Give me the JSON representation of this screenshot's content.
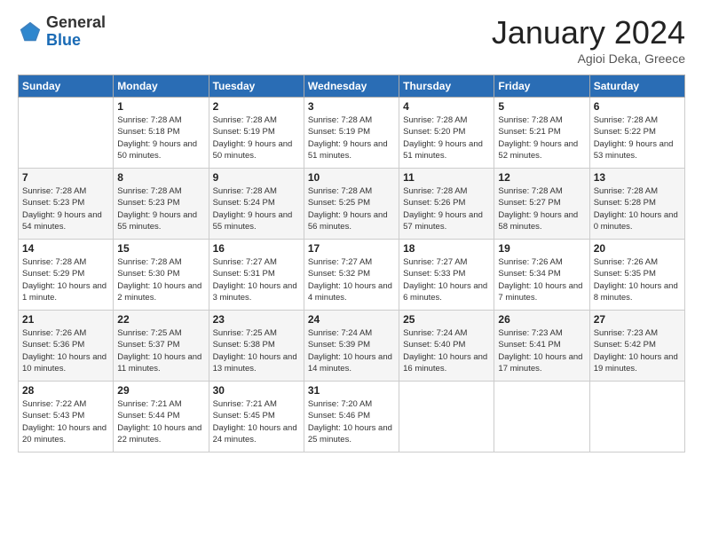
{
  "logo": {
    "general": "General",
    "blue": "Blue"
  },
  "header": {
    "title": "January 2024",
    "location": "Agioi Deka, Greece"
  },
  "weekdays": [
    "Sunday",
    "Monday",
    "Tuesday",
    "Wednesday",
    "Thursday",
    "Friday",
    "Saturday"
  ],
  "weeks": [
    [
      {
        "day": "",
        "sunrise": "",
        "sunset": "",
        "daylight": ""
      },
      {
        "day": "1",
        "sunrise": "7:28 AM",
        "sunset": "5:18 PM",
        "daylight": "9 hours and 50 minutes."
      },
      {
        "day": "2",
        "sunrise": "7:28 AM",
        "sunset": "5:19 PM",
        "daylight": "9 hours and 50 minutes."
      },
      {
        "day": "3",
        "sunrise": "7:28 AM",
        "sunset": "5:19 PM",
        "daylight": "9 hours and 51 minutes."
      },
      {
        "day": "4",
        "sunrise": "7:28 AM",
        "sunset": "5:20 PM",
        "daylight": "9 hours and 51 minutes."
      },
      {
        "day": "5",
        "sunrise": "7:28 AM",
        "sunset": "5:21 PM",
        "daylight": "9 hours and 52 minutes."
      },
      {
        "day": "6",
        "sunrise": "7:28 AM",
        "sunset": "5:22 PM",
        "daylight": "9 hours and 53 minutes."
      }
    ],
    [
      {
        "day": "7",
        "sunrise": "7:28 AM",
        "sunset": "5:23 PM",
        "daylight": "9 hours and 54 minutes."
      },
      {
        "day": "8",
        "sunrise": "7:28 AM",
        "sunset": "5:23 PM",
        "daylight": "9 hours and 55 minutes."
      },
      {
        "day": "9",
        "sunrise": "7:28 AM",
        "sunset": "5:24 PM",
        "daylight": "9 hours and 55 minutes."
      },
      {
        "day": "10",
        "sunrise": "7:28 AM",
        "sunset": "5:25 PM",
        "daylight": "9 hours and 56 minutes."
      },
      {
        "day": "11",
        "sunrise": "7:28 AM",
        "sunset": "5:26 PM",
        "daylight": "9 hours and 57 minutes."
      },
      {
        "day": "12",
        "sunrise": "7:28 AM",
        "sunset": "5:27 PM",
        "daylight": "9 hours and 58 minutes."
      },
      {
        "day": "13",
        "sunrise": "7:28 AM",
        "sunset": "5:28 PM",
        "daylight": "10 hours and 0 minutes."
      }
    ],
    [
      {
        "day": "14",
        "sunrise": "7:28 AM",
        "sunset": "5:29 PM",
        "daylight": "10 hours and 1 minute."
      },
      {
        "day": "15",
        "sunrise": "7:28 AM",
        "sunset": "5:30 PM",
        "daylight": "10 hours and 2 minutes."
      },
      {
        "day": "16",
        "sunrise": "7:27 AM",
        "sunset": "5:31 PM",
        "daylight": "10 hours and 3 minutes."
      },
      {
        "day": "17",
        "sunrise": "7:27 AM",
        "sunset": "5:32 PM",
        "daylight": "10 hours and 4 minutes."
      },
      {
        "day": "18",
        "sunrise": "7:27 AM",
        "sunset": "5:33 PM",
        "daylight": "10 hours and 6 minutes."
      },
      {
        "day": "19",
        "sunrise": "7:26 AM",
        "sunset": "5:34 PM",
        "daylight": "10 hours and 7 minutes."
      },
      {
        "day": "20",
        "sunrise": "7:26 AM",
        "sunset": "5:35 PM",
        "daylight": "10 hours and 8 minutes."
      }
    ],
    [
      {
        "day": "21",
        "sunrise": "7:26 AM",
        "sunset": "5:36 PM",
        "daylight": "10 hours and 10 minutes."
      },
      {
        "day": "22",
        "sunrise": "7:25 AM",
        "sunset": "5:37 PM",
        "daylight": "10 hours and 11 minutes."
      },
      {
        "day": "23",
        "sunrise": "7:25 AM",
        "sunset": "5:38 PM",
        "daylight": "10 hours and 13 minutes."
      },
      {
        "day": "24",
        "sunrise": "7:24 AM",
        "sunset": "5:39 PM",
        "daylight": "10 hours and 14 minutes."
      },
      {
        "day": "25",
        "sunrise": "7:24 AM",
        "sunset": "5:40 PM",
        "daylight": "10 hours and 16 minutes."
      },
      {
        "day": "26",
        "sunrise": "7:23 AM",
        "sunset": "5:41 PM",
        "daylight": "10 hours and 17 minutes."
      },
      {
        "day": "27",
        "sunrise": "7:23 AM",
        "sunset": "5:42 PM",
        "daylight": "10 hours and 19 minutes."
      }
    ],
    [
      {
        "day": "28",
        "sunrise": "7:22 AM",
        "sunset": "5:43 PM",
        "daylight": "10 hours and 20 minutes."
      },
      {
        "day": "29",
        "sunrise": "7:21 AM",
        "sunset": "5:44 PM",
        "daylight": "10 hours and 22 minutes."
      },
      {
        "day": "30",
        "sunrise": "7:21 AM",
        "sunset": "5:45 PM",
        "daylight": "10 hours and 24 minutes."
      },
      {
        "day": "31",
        "sunrise": "7:20 AM",
        "sunset": "5:46 PM",
        "daylight": "10 hours and 25 minutes."
      },
      {
        "day": "",
        "sunrise": "",
        "sunset": "",
        "daylight": ""
      },
      {
        "day": "",
        "sunrise": "",
        "sunset": "",
        "daylight": ""
      },
      {
        "day": "",
        "sunrise": "",
        "sunset": "",
        "daylight": ""
      }
    ]
  ]
}
